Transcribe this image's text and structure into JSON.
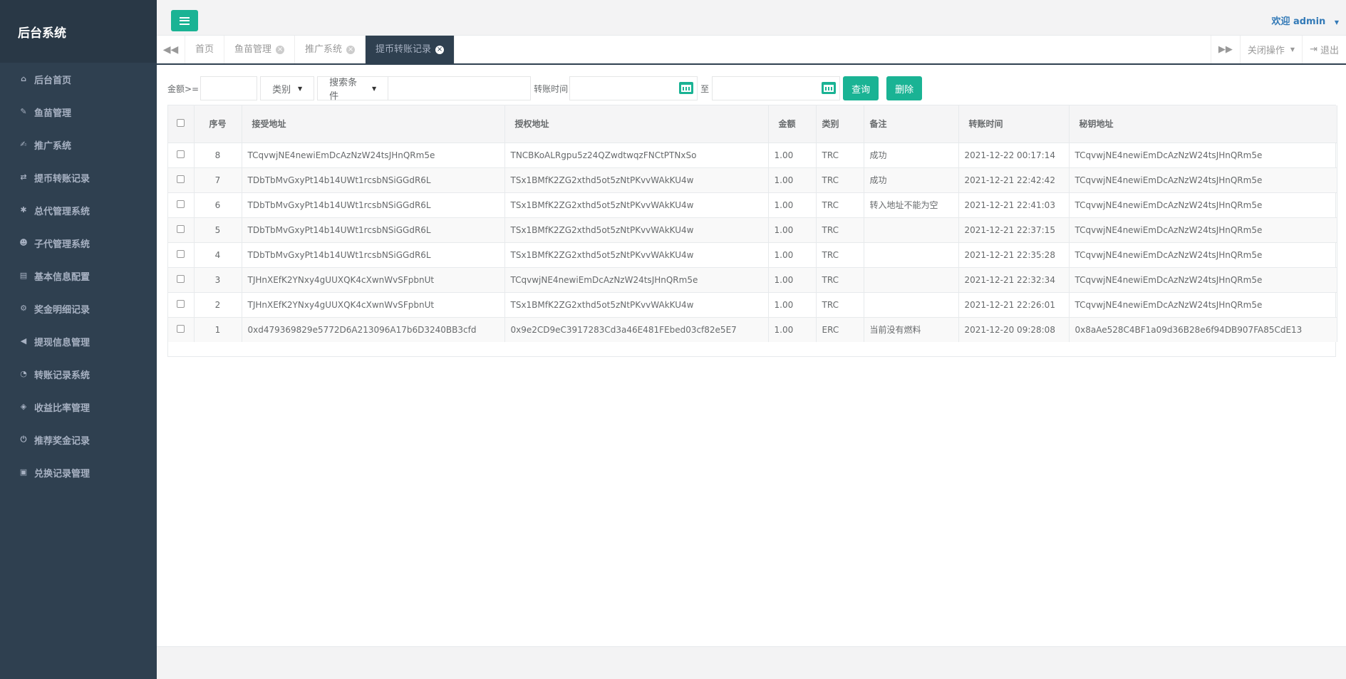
{
  "sidebar": {
    "title": "后台系统",
    "items": [
      {
        "label": "后台首页",
        "icon": "home-icon"
      },
      {
        "label": "鱼苗管理",
        "icon": "wrench-icon"
      },
      {
        "label": "推广系统",
        "icon": "edit-icon"
      },
      {
        "label": "提币转账记录",
        "icon": "shuffle-icon"
      },
      {
        "label": "总代管理系统",
        "icon": "asterisk-icon"
      },
      {
        "label": "子代管理系统",
        "icon": "users-icon"
      },
      {
        "label": "基本信息配置",
        "icon": "file-icon"
      },
      {
        "label": "奖金明细记录",
        "icon": "cogs-icon"
      },
      {
        "label": "提现信息管理",
        "icon": "bullhorn-icon"
      },
      {
        "label": "转账记录系统",
        "icon": "dashboard-icon"
      },
      {
        "label": "收益比率管理",
        "icon": "shield-icon"
      },
      {
        "label": "推荐奖金记录",
        "icon": "power-icon"
      },
      {
        "label": "兑换记录管理",
        "icon": "save-icon"
      }
    ]
  },
  "header": {
    "welcome": "欢迎 admin"
  },
  "tabs": [
    {
      "label": "首页",
      "closable": false,
      "active": false
    },
    {
      "label": "鱼苗管理",
      "closable": true,
      "active": false
    },
    {
      "label": "推广系统",
      "closable": true,
      "active": false
    },
    {
      "label": "提币转账记录",
      "closable": true,
      "active": true
    }
  ],
  "tab_right": {
    "close_ops": "关闭操作",
    "logout": "退出"
  },
  "search": {
    "amount_label": "金额>=",
    "amount_value": "",
    "category_label": "类别",
    "condition_label": "搜索条件",
    "keyword_value": "",
    "time_label": "转账时间",
    "time_start": "",
    "to_label": "至",
    "time_end": "",
    "query_button": "查询",
    "delete_button": "删除"
  },
  "table": {
    "headers": [
      "序号",
      "接受地址",
      "授权地址",
      "金额",
      "类别",
      "备注",
      "转账时间",
      "秘钥地址"
    ],
    "rows": [
      [
        "8",
        "TCqvwjNE4newiEmDcAzNzW24tsJHnQRm5e",
        "TNCBKoALRgpu5z24QZwdtwqzFNCtPTNxSo",
        "1.00",
        "TRC",
        "成功",
        "2021-12-22 00:17:14",
        "TCqvwjNE4newiEmDcAzNzW24tsJHnQRm5e"
      ],
      [
        "7",
        "TDbTbMvGxyPt14b14UWt1rcsbNSiGGdR6L",
        "TSx1BMfK2ZG2xthd5ot5zNtPKvvWAkKU4w",
        "1.00",
        "TRC",
        "成功",
        "2021-12-21 22:42:42",
        "TCqvwjNE4newiEmDcAzNzW24tsJHnQRm5e"
      ],
      [
        "6",
        "TDbTbMvGxyPt14b14UWt1rcsbNSiGGdR6L",
        "TSx1BMfK2ZG2xthd5ot5zNtPKvvWAkKU4w",
        "1.00",
        "TRC",
        "转入地址不能为空",
        "2021-12-21 22:41:03",
        "TCqvwjNE4newiEmDcAzNzW24tsJHnQRm5e"
      ],
      [
        "5",
        "TDbTbMvGxyPt14b14UWt1rcsbNSiGGdR6L",
        "TSx1BMfK2ZG2xthd5ot5zNtPKvvWAkKU4w",
        "1.00",
        "TRC",
        "",
        "2021-12-21 22:37:15",
        "TCqvwjNE4newiEmDcAzNzW24tsJHnQRm5e"
      ],
      [
        "4",
        "TDbTbMvGxyPt14b14UWt1rcsbNSiGGdR6L",
        "TSx1BMfK2ZG2xthd5ot5zNtPKvvWAkKU4w",
        "1.00",
        "TRC",
        "",
        "2021-12-21 22:35:28",
        "TCqvwjNE4newiEmDcAzNzW24tsJHnQRm5e"
      ],
      [
        "3",
        "TJHnXEfK2YNxy4gUUXQK4cXwnWvSFpbnUt",
        "TCqvwjNE4newiEmDcAzNzW24tsJHnQRm5e",
        "1.00",
        "TRC",
        "",
        "2021-12-21 22:32:34",
        "TCqvwjNE4newiEmDcAzNzW24tsJHnQRm5e"
      ],
      [
        "2",
        "TJHnXEfK2YNxy4gUUXQK4cXwnWvSFpbnUt",
        "TSx1BMfK2ZG2xthd5ot5zNtPKvvWAkKU4w",
        "1.00",
        "TRC",
        "",
        "2021-12-21 22:26:01",
        "TCqvwjNE4newiEmDcAzNzW24tsJHnQRm5e"
      ],
      [
        "1",
        "0xd479369829e5772D6A213096A17b6D3240BB3cfd",
        "0x9e2CD9eC3917283Cd3a46E481FEbed03cf82e5E7",
        "1.00",
        "ERC",
        "当前没有燃料",
        "2021-12-20 09:28:08",
        "0x8aAe528C4BF1a09d36B28e6f94DB907FA85CdE13"
      ]
    ]
  },
  "colors": {
    "sidebar_bg": "#2f4050",
    "accent": "#1ab394",
    "link": "#337ab7"
  }
}
